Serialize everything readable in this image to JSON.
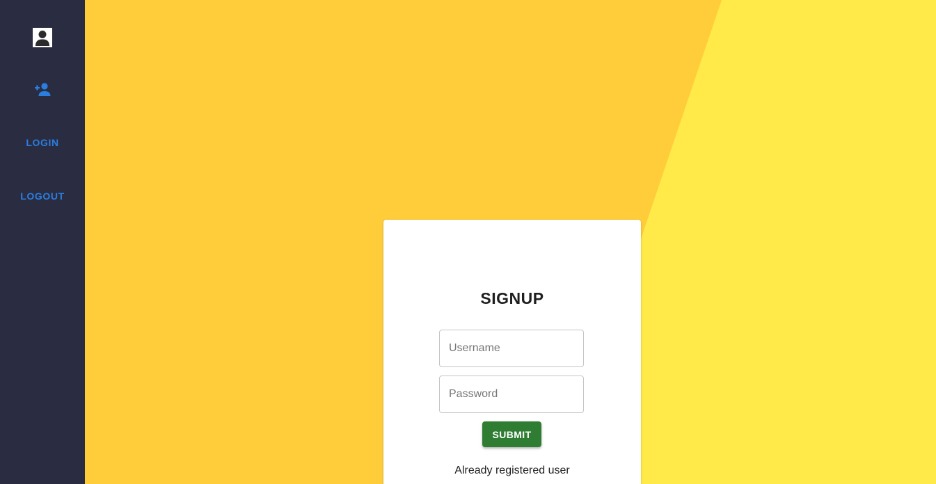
{
  "sidebar": {
    "avatar_icon": "account-box-icon",
    "add_user_icon": "person-add-icon",
    "login_label": "LOGIN",
    "logout_label": "LOGOUT"
  },
  "form": {
    "title": "SIGNUP",
    "username": {
      "value": "",
      "placeholder": "Username"
    },
    "password": {
      "value": "",
      "placeholder": "Password"
    },
    "submit_label": "SUBMIT",
    "already_registered_text": "Already registered user"
  },
  "colors": {
    "sidebar_bg": "#2a2c41",
    "link_blue": "#2a7ee0",
    "background_left": "#ffcd3a",
    "background_right": "#ffea4a",
    "submit_green": "#2e7d32"
  }
}
